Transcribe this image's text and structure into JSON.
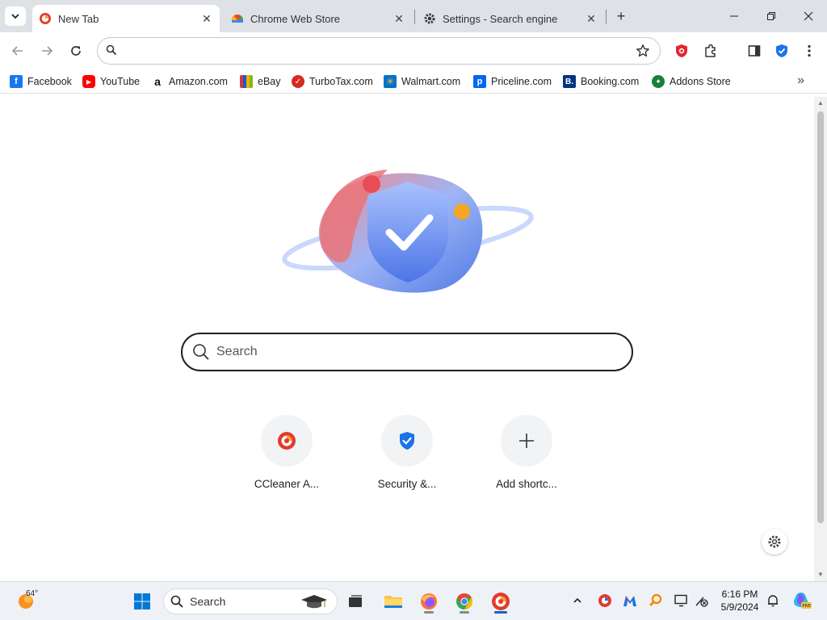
{
  "tabs": [
    {
      "title": "New Tab",
      "active": true,
      "icon": "ccleaner-icon"
    },
    {
      "title": "Chrome Web Store",
      "active": false,
      "icon": "chrome-web-store-icon"
    },
    {
      "title": "Settings - Search engine",
      "active": false,
      "icon": "gear-icon"
    }
  ],
  "omnibox": {
    "value": "",
    "placeholder": ""
  },
  "bookmarks": [
    {
      "label": "Facebook",
      "icon": "facebook-icon",
      "color": "#1877f2"
    },
    {
      "label": "YouTube",
      "icon": "youtube-icon",
      "color": "#ff0000"
    },
    {
      "label": "Amazon.com",
      "icon": "amazon-icon",
      "color": "#111111"
    },
    {
      "label": "eBay",
      "icon": "ebay-icon",
      "color": "#e53238"
    },
    {
      "label": "TurboTax.com",
      "icon": "turbotax-icon",
      "color": "#d52b1e"
    },
    {
      "label": "Walmart.com",
      "icon": "walmart-icon",
      "color": "#0071ce"
    },
    {
      "label": "Priceline.com",
      "icon": "priceline-icon",
      "color": "#0068ef"
    },
    {
      "label": "Booking.com",
      "icon": "booking-icon",
      "color": "#003580"
    },
    {
      "label": "Addons Store",
      "icon": "addons-store-icon",
      "color": "#188038"
    }
  ],
  "ntp": {
    "search_placeholder": "Search",
    "shortcuts": [
      {
        "label": "CCleaner A...",
        "icon": "ccleaner-icon"
      },
      {
        "label": "Security &...",
        "icon": "shield-check-icon"
      },
      {
        "label": "Add shortc...",
        "icon": "plus-icon"
      }
    ]
  },
  "taskbar": {
    "weather_temp": "64°",
    "search_label": "Search",
    "time": "6:16 PM",
    "date": "5/9/2024"
  },
  "colors": {
    "accent": "#1a73e8",
    "tabstrip": "#dee1e6",
    "taskbar": "#eef2f7"
  }
}
